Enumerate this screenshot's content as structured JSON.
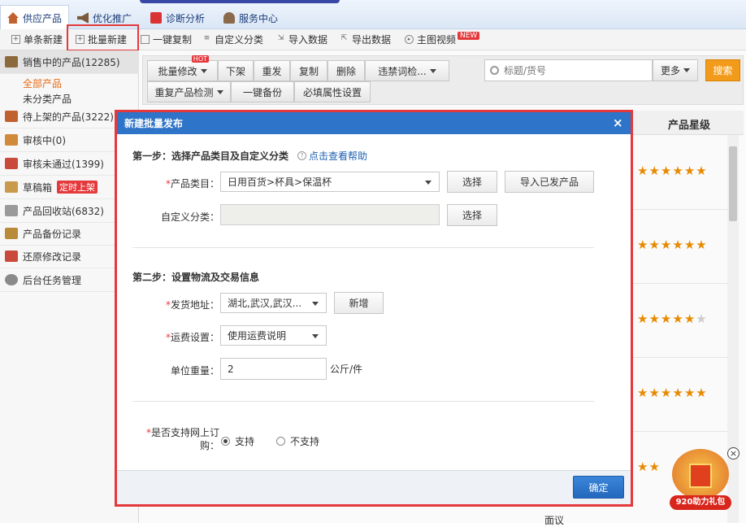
{
  "nav": {
    "tabs": [
      {
        "label": "供应产品",
        "icon": "home-icon"
      },
      {
        "label": "优化推广",
        "icon": "megaphone-icon"
      },
      {
        "label": "诊断分析",
        "icon": "medical-kit-icon"
      },
      {
        "label": "服务中心",
        "icon": "person-icon"
      }
    ]
  },
  "toolbar": {
    "single_new": "单条新建",
    "batch_new": "批量新建",
    "copy": "一键复制",
    "custom_cat": "自定义分类",
    "import": "导入数据",
    "export": "导出数据",
    "video": "主图视频",
    "video_tag": "NEW"
  },
  "sidebar": {
    "selling": "销售中的产品(12285)",
    "all": "全部产品",
    "uncat": "未分类产品",
    "pending": "待上架的产品(3222)",
    "review": "审核中(0)",
    "rejected": "审核未通过(1399)",
    "draft": "草稿箱",
    "draft_tag": "定时上架",
    "recycle": "产品回收站(6832)",
    "backup": "产品备份记录",
    "restore": "还原修改记录",
    "tasks": "后台任务管理"
  },
  "actions": {
    "batch_edit": "批量修改",
    "hot": "HOT",
    "offline": "下架",
    "republish": "重发",
    "copy": "复制",
    "delete": "删除",
    "banned": "违禁词检...",
    "dup_check": "重复产品检测",
    "backup": "一键备份",
    "required": "必填属性设置",
    "search_placeholder": "标题/货号",
    "more": "更多",
    "search": "搜索"
  },
  "table": {
    "col_rating": "产品星级",
    "ratings": [
      6,
      6,
      5,
      6
    ],
    "bottom_text": "面议"
  },
  "dialog": {
    "title": "新建批量发布",
    "close": "×",
    "step1": "第一步：选择产品类目及自定义分类",
    "help": "点击查看帮助",
    "cat_label": "产品类目：",
    "cat_value": "日用百货>杯具>保温杯",
    "choose": "选择",
    "import_published": "导入已发产品",
    "custom_label": "自定义分类：",
    "choose2": "选择",
    "step2": "第二步：设置物流及交易信息",
    "ship_label": "发货地址：",
    "ship_value": "湖北,武汉,武汉...",
    "add": "新增",
    "fee_label": "运费设置：",
    "fee_value": "使用运费说明",
    "weight_label": "单位重量：",
    "weight_value": "2",
    "weight_unit": "公斤/件",
    "online_label_1": "是否支持网上订",
    "online_label_2": "购：",
    "support": "支持",
    "nosupport": "不支持",
    "ok": "确定"
  },
  "promo": {
    "text": "920助力礼包",
    "close": "×"
  }
}
